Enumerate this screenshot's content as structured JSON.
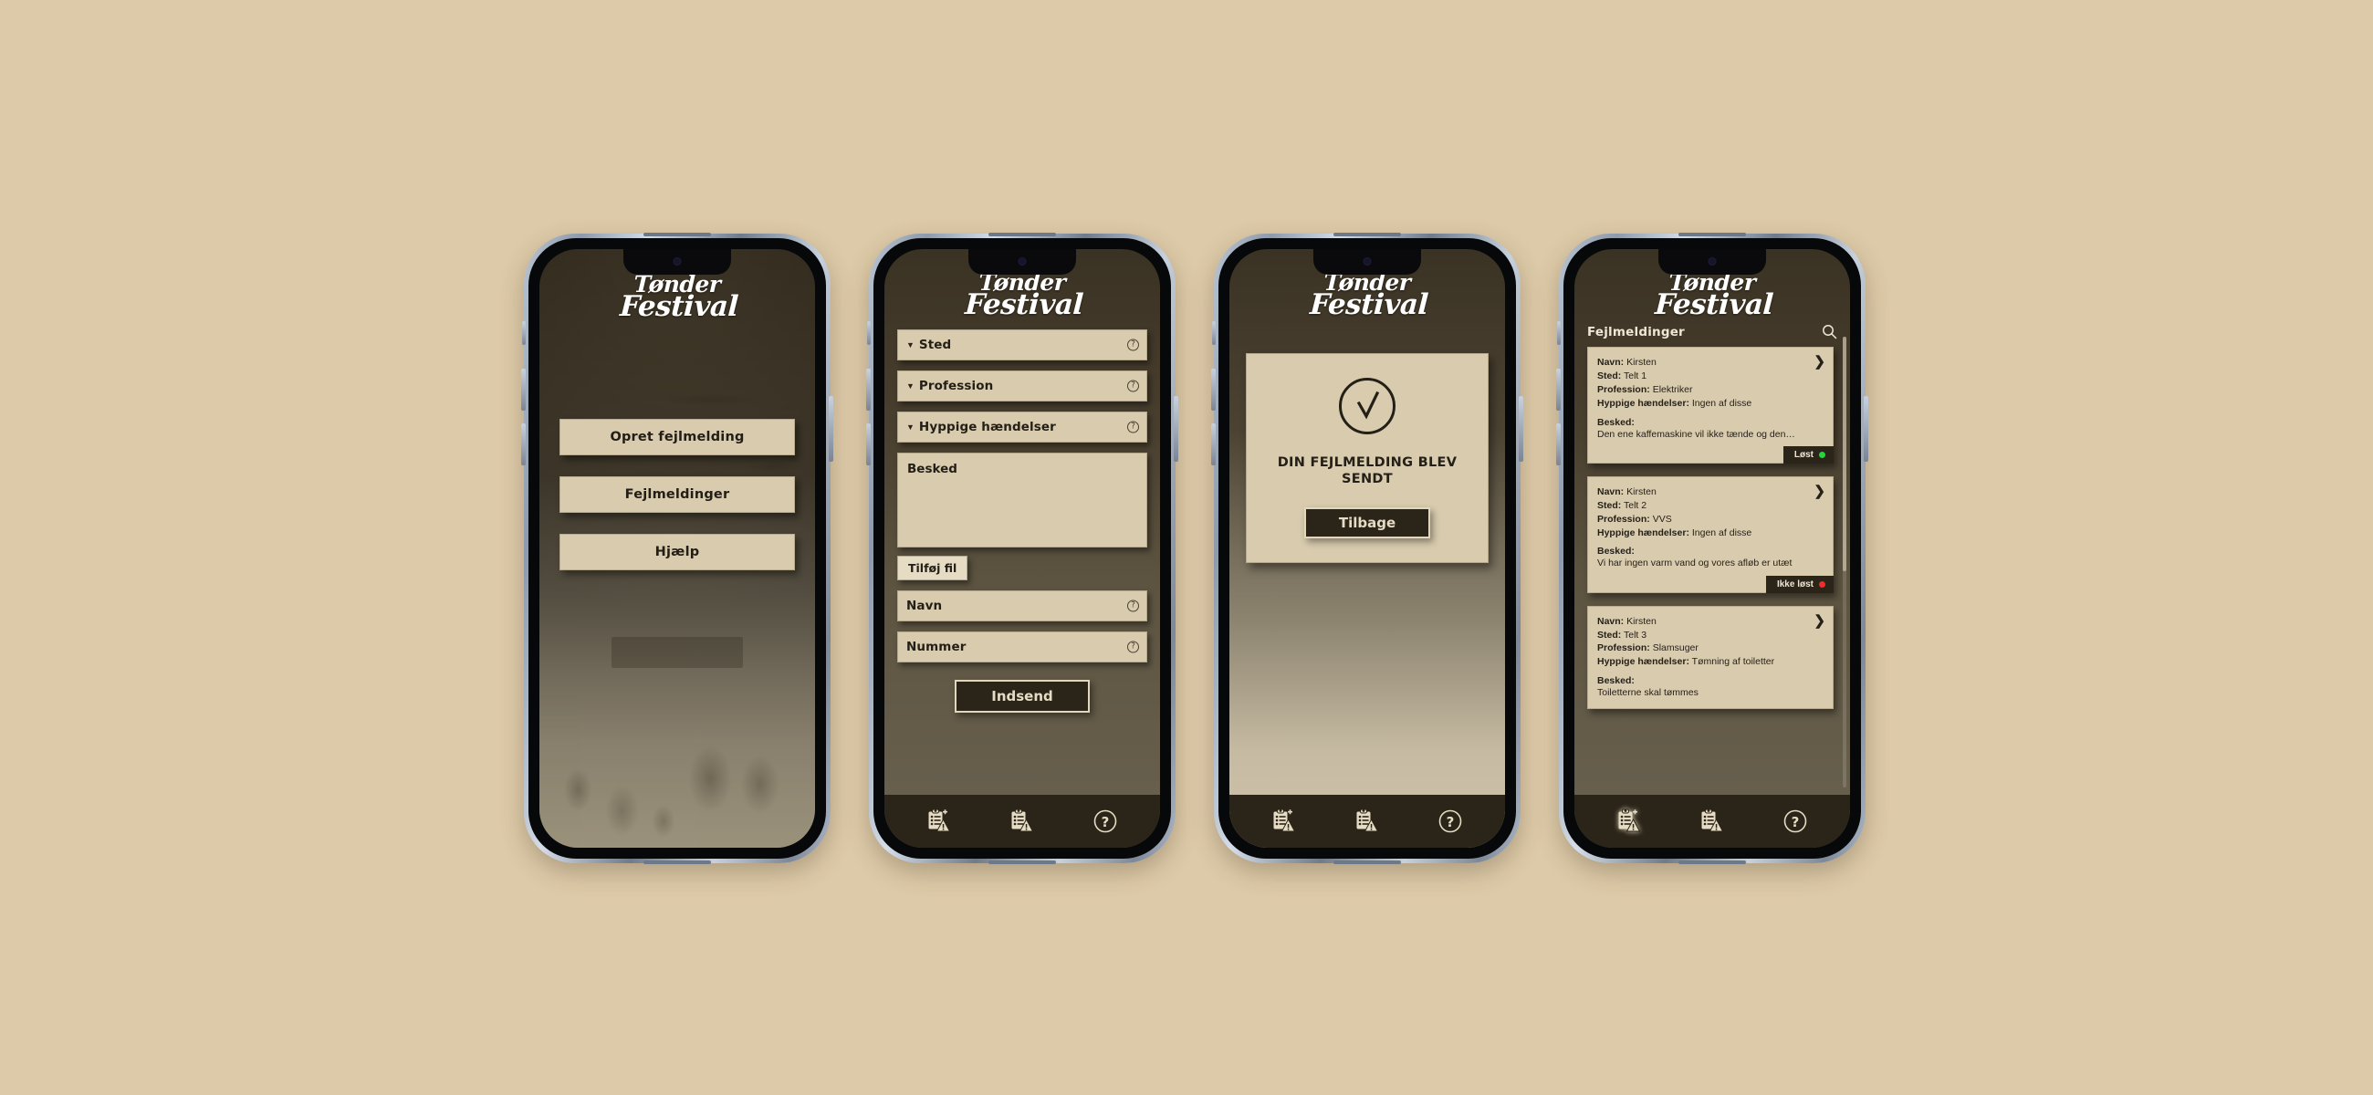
{
  "page": {
    "background_color": "#ddcaa8"
  },
  "brand": {
    "logo_line1": "Tønder",
    "logo_line2": "Festival",
    "accent_dark": "#2b2418",
    "accent_light": "#d8cbae"
  },
  "tabbar": {
    "items": [
      {
        "name": "create-report",
        "label": "Opret fejlmelding",
        "icon": "clipboard-plus-warning-icon"
      },
      {
        "name": "reports-list",
        "label": "Fejlmeldinger",
        "icon": "clipboard-warning-icon"
      },
      {
        "name": "help",
        "label": "Hjælp",
        "icon": "question-circle-icon"
      }
    ]
  },
  "screens": [
    {
      "id": "home",
      "name": "home-screen",
      "buttons": [
        {
          "label": "Opret fejlmelding"
        },
        {
          "label": "Fejlmeldinger"
        },
        {
          "label": "Hjælp"
        }
      ]
    },
    {
      "id": "form",
      "name": "create-report-screen",
      "dropdowns": [
        {
          "label": "Sted",
          "help": "?"
        },
        {
          "label": "Profession",
          "help": "?"
        },
        {
          "label": "Hyppige hændelser",
          "help": "?"
        }
      ],
      "message": {
        "label": "Besked",
        "value": "",
        "placeholder": "Besked"
      },
      "file_button": {
        "label": "Tilføj fil"
      },
      "inputs": [
        {
          "label": "Navn",
          "value": "",
          "placeholder": "Navn",
          "help": "?"
        },
        {
          "label": "Nummer",
          "value": "",
          "placeholder": "Nummer",
          "help": "?"
        }
      ],
      "submit": {
        "label": "Indsend"
      }
    },
    {
      "id": "confirmation",
      "name": "confirmation-screen",
      "icon": "check-circle-icon",
      "title": "DIN FEJLMELDING BLEV SENDT",
      "back_button": {
        "label": "Tilbage"
      }
    },
    {
      "id": "reports",
      "name": "reports-list-screen",
      "header": {
        "title": "Fejlmeldinger",
        "search_icon": "search-icon"
      },
      "labels": {
        "navn": "Navn:",
        "sted": "Sted:",
        "profession": "Profession:",
        "haendelser": "Hyppige hændelser:",
        "besked": "Besked:"
      },
      "cards": [
        {
          "navn": "Kirsten",
          "sted": "Telt 1",
          "profession": "Elektriker",
          "haendelser": "Ingen af disse",
          "besked": "Den ene kaffemaskine vil ikke tænde og den…",
          "status": {
            "label": "Løst",
            "color": "#22d63c"
          }
        },
        {
          "navn": "Kirsten",
          "sted": "Telt 2",
          "profession": "VVS",
          "haendelser": "Ingen af disse",
          "besked": "Vi har ingen varm vand og vores afløb er utæt",
          "status": {
            "label": "Ikke løst",
            "color": "#ef2d2d"
          }
        },
        {
          "navn": "Kirsten",
          "sted": "Telt 3",
          "profession": "Slamsuger",
          "haendelser": "Tømning af toiletter",
          "besked": "Toiletterne skal tømmes",
          "status": null
        }
      ]
    }
  ]
}
